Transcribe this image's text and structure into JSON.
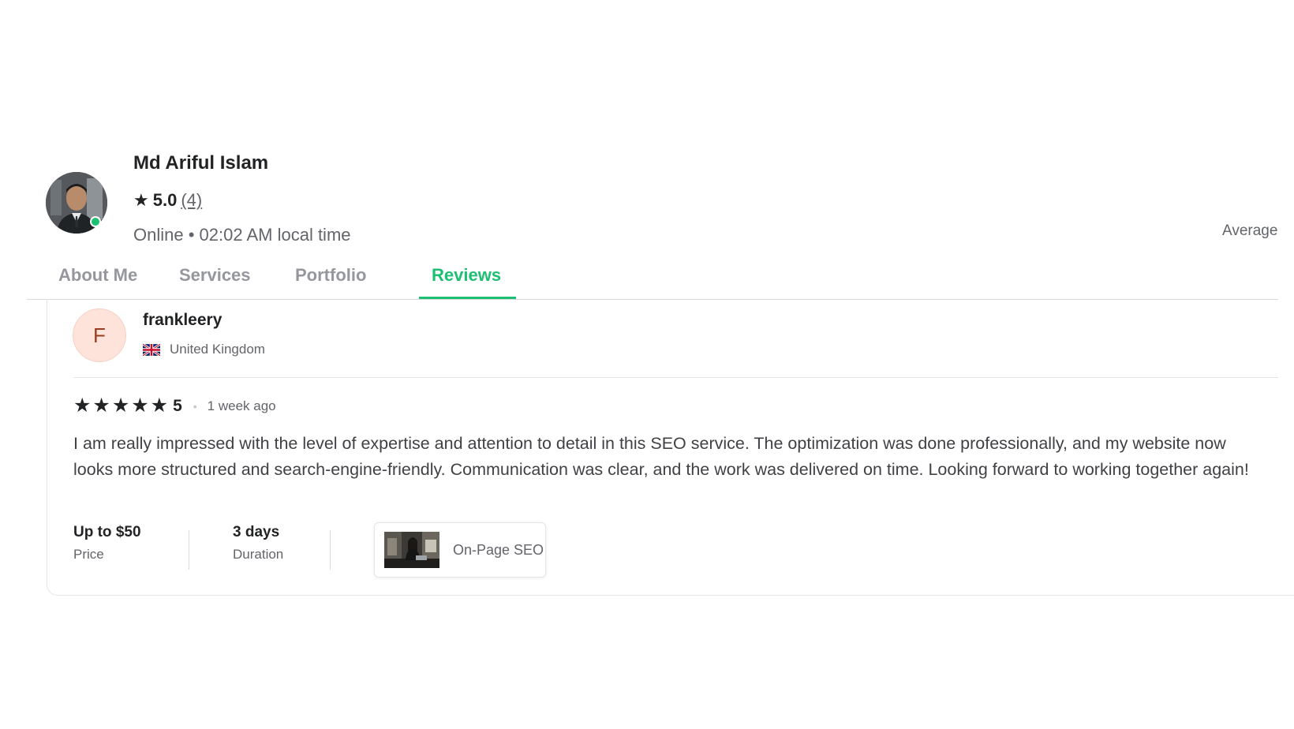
{
  "seller": {
    "name": "Md Ariful Islam",
    "rating": "5.0",
    "review_count": "(4)",
    "status": "Online • 02:02 AM local time",
    "average_label": "Average"
  },
  "tabs": [
    {
      "label": "About Me",
      "active": false
    },
    {
      "label": "Services",
      "active": false
    },
    {
      "label": "Portfolio",
      "active": false
    },
    {
      "label": "Reviews",
      "active": true
    }
  ],
  "review": {
    "initial": "F",
    "reviewer": "frankleery",
    "country": "United Kingdom",
    "stars": "★★★★★",
    "rating": "5",
    "separator": "•",
    "time_ago": "1 week ago",
    "text": "I am really impressed with the level of expertise and attention to detail in this SEO service. The optimization was done professionally, and my website now looks more structured and search-engine-friendly. Communication was clear, and the work was delivered on time. Looking forward to working together again!",
    "price_value": "Up to $50",
    "price_label": "Price",
    "duration_value": "3 days",
    "duration_label": "Duration",
    "service_name": "On-Page SEO"
  },
  "colors": {
    "accent": "#1dbf73",
    "text_primary": "#222325",
    "text_secondary": "#62646a",
    "avatar_bg": "#fde3da"
  },
  "icons": {
    "rating_star": "star-icon",
    "country_flag": "uk-flag-icon",
    "online_indicator": "online-dot-icon"
  }
}
